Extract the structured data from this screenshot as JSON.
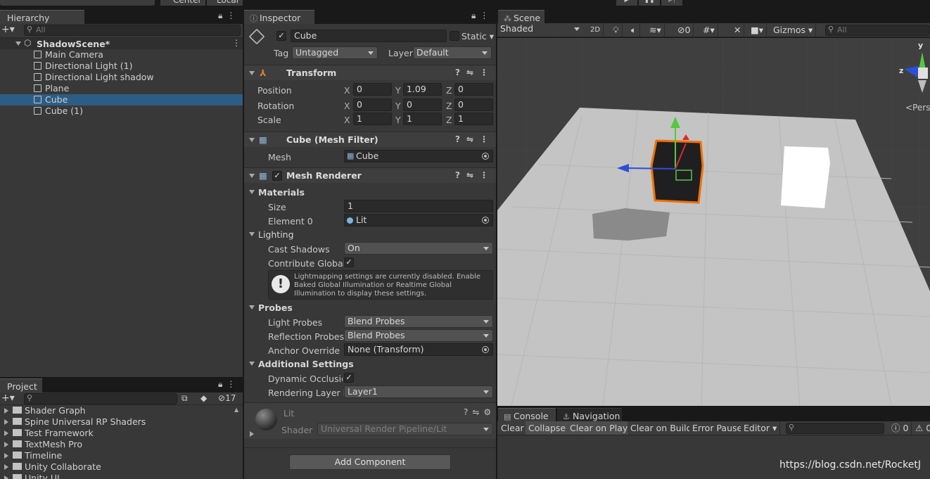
{
  "hierarchy": {
    "tab_label": "Hierarchy",
    "search_placeholder": "All",
    "scene_name": "ShadowScene*",
    "items": [
      {
        "label": "Main Camera"
      },
      {
        "label": "Directional Light (1)"
      },
      {
        "label": "Directional Light shadow"
      },
      {
        "label": "Plane"
      },
      {
        "label": "Cube"
      },
      {
        "label": "Cube (1)"
      }
    ],
    "selected": "Cube"
  },
  "project": {
    "tab_label": "Project",
    "badge_count": "17",
    "folders": [
      {
        "label": "Shader Graph"
      },
      {
        "label": "Spine Universal RP Shaders"
      },
      {
        "label": "Test Framework"
      },
      {
        "label": "TextMesh Pro"
      },
      {
        "label": "Timeline"
      },
      {
        "label": "Unity Collaborate"
      },
      {
        "label": "Unity UI"
      }
    ]
  },
  "inspector": {
    "tab_label": "Inspector",
    "object_name": "Cube",
    "static_label": "Static",
    "tag_label": "Tag",
    "tag_value": "Untagged",
    "layer_label": "Layer",
    "layer_value": "Default",
    "transform": {
      "title": "Transform",
      "rows": [
        {
          "label": "Position",
          "x": "0",
          "y": "1.09",
          "z": "0"
        },
        {
          "label": "Rotation",
          "x": "0",
          "y": "0",
          "z": "0"
        },
        {
          "label": "Scale",
          "x": "1",
          "y": "1",
          "z": "1"
        }
      ],
      "axis_x": "X",
      "axis_y": "Y",
      "axis_z": "Z"
    },
    "mesh_filter": {
      "title": "Cube (Mesh Filter)",
      "mesh_label": "Mesh",
      "mesh_value": "Cube"
    },
    "mesh_renderer": {
      "title": "Mesh Renderer",
      "materials_label": "Materials",
      "size_label": "Size",
      "size_value": "1",
      "element0_label": "Element 0",
      "element0_value": "Lit",
      "lighting_label": "Lighting",
      "cast_shadows_label": "Cast Shadows",
      "cast_shadows_value": "On",
      "contribute_gi_label": "Contribute Global Il",
      "info_text": "Lightmapping settings are currently disabled. Enable Baked Global Illumination or Realtime Global Illumination to display these settings.",
      "probes_label": "Probes",
      "light_probes_label": "Light Probes",
      "light_probes_value": "Blend Probes",
      "reflection_probes_label": "Reflection Probes",
      "reflection_probes_value": "Blend Probes",
      "anchor_override_label": "Anchor Override",
      "anchor_override_value": "None (Transform)",
      "additional_label": "Additional Settings",
      "dynamic_occlusion_label": "Dynamic Occlusion",
      "rendering_layer_label": "Rendering Layer M",
      "rendering_layer_value": "Layer1"
    },
    "material": {
      "name": "Lit",
      "shader_label": "Shader",
      "shader_value": "Universal Render Pipeline/Lit"
    },
    "add_component": "Add Component"
  },
  "scene": {
    "tab_label": "Scene",
    "shading_mode": "Shaded",
    "mode_2d": "2D",
    "hidden_count": "0",
    "gizmos_label": "Gizmos",
    "search_placeholder": "All",
    "persp_label": "Pers",
    "axis_y": "y",
    "axis_z": "z"
  },
  "console": {
    "tab_label": "Console",
    "nav_tab_label": "Navigation",
    "buttons": [
      "Clear",
      "Collapse",
      "Clear on Play",
      "Clear on Build",
      "Error Pause",
      "Editor"
    ],
    "info_count": "0",
    "warn_count": "0"
  },
  "toolbar": {
    "center_label": "Center",
    "local_label": "Local"
  },
  "watermark": "https://blog.csdn.net/RocketJ"
}
